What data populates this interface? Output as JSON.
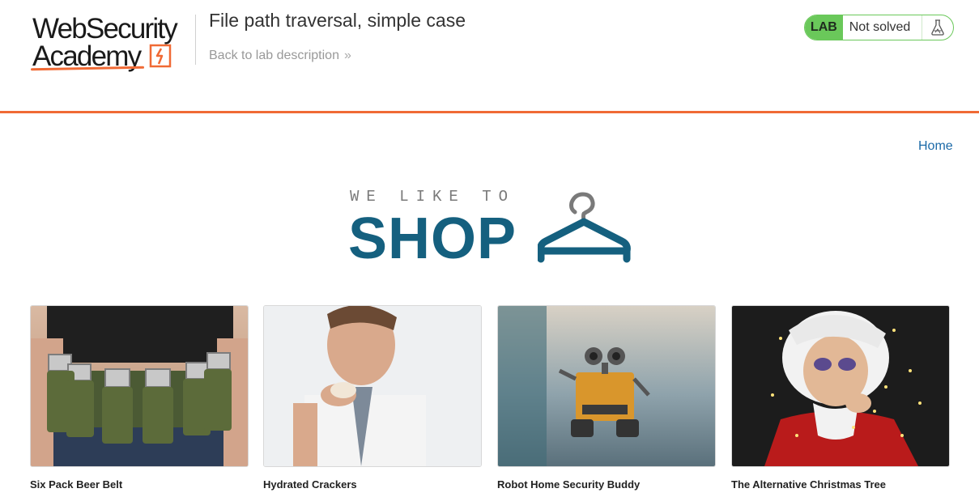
{
  "header": {
    "logo_line1": "WebSecurity",
    "logo_line2": "Academy",
    "lab_title": "File path traversal, simple case",
    "back_link": "Back to lab description",
    "back_chevron": "»",
    "badge_label": "LAB",
    "badge_status": "Not solved",
    "badge_icon": "flask-icon",
    "accent_color": "#f06a35",
    "badge_color": "#6ac85a"
  },
  "nav": {
    "home": "Home"
  },
  "banner": {
    "tagline": "WE LIKE TO",
    "word": "SHOP",
    "icon": "hanger-icon",
    "color": "#15607f"
  },
  "products": [
    {
      "title": "Six Pack Beer Belt",
      "image": "beer-belt-photo"
    },
    {
      "title": "Hydrated Crackers",
      "image": "man-eating-cracker-photo"
    },
    {
      "title": "Robot Home Security Buddy",
      "image": "robot-photo"
    },
    {
      "title": "The Alternative Christmas Tree",
      "image": "santa-with-lights-photo"
    }
  ]
}
